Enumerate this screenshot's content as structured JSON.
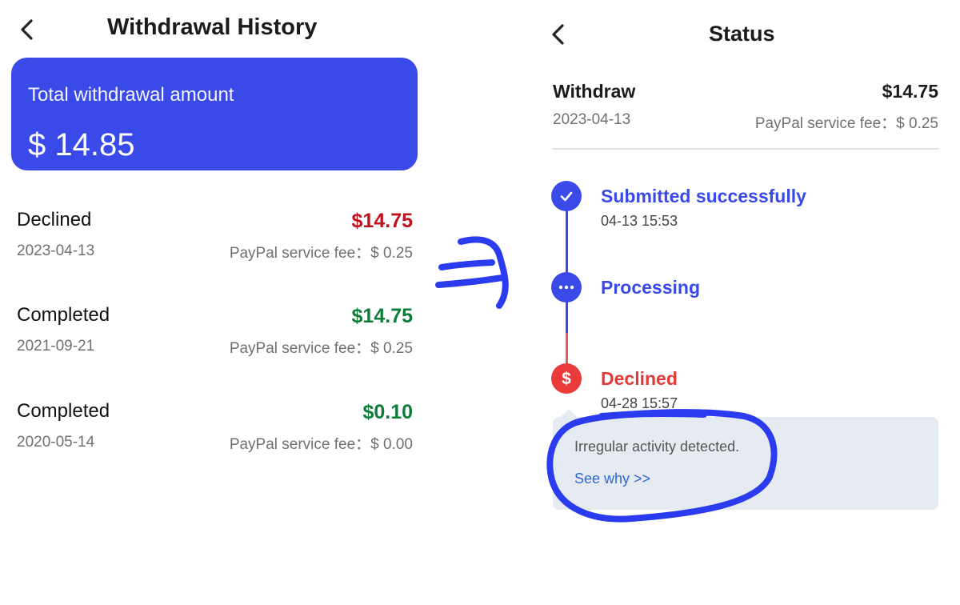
{
  "left_screen": {
    "title": "Withdrawal History",
    "total_card": {
      "label": "Total withdrawal amount",
      "amount": "$ 14.85",
      "color": "#3a4ae8"
    },
    "history": [
      {
        "status": "Declined",
        "amount": "$14.75",
        "amount_color": "#c0121d",
        "date": "2023-04-13",
        "fee": "PayPal service fee：$ 0.25"
      },
      {
        "status": "Completed",
        "amount": "$14.75",
        "amount_color": "#0f7d3a",
        "date": "2021-09-21",
        "fee": "PayPal service fee：$ 0.25"
      },
      {
        "status": "Completed",
        "amount": "$0.10",
        "amount_color": "#0f7d3a",
        "date": "2020-05-14",
        "fee": "PayPal service fee：$ 0.00"
      }
    ]
  },
  "right_screen": {
    "title": "Status",
    "withdraw": {
      "label": "Withdraw",
      "amount": "$14.75",
      "date": "2023-04-13",
      "fee": "PayPal service fee：$ 0.25"
    },
    "timeline": [
      {
        "title": "Submitted successfully",
        "time": "04-13 15:53",
        "icon": "check-icon",
        "color": "#3a4ae8"
      },
      {
        "title": "Processing",
        "time": "",
        "icon": "ellipsis-icon",
        "color": "#3a4ae8"
      },
      {
        "title": "Declined",
        "time": "04-28 15:57",
        "icon": "dollar-icon",
        "color": "#e53838"
      }
    ],
    "note": {
      "text": "Irregular activity detected.",
      "link": "See why >>"
    },
    "dollar_glyph": "$"
  },
  "colors": {
    "accent_blue": "#3a4ae8",
    "declined_red": "#e53838",
    "completed_green": "#0f7d3a",
    "annotation_ink": "#2b3cf0"
  }
}
